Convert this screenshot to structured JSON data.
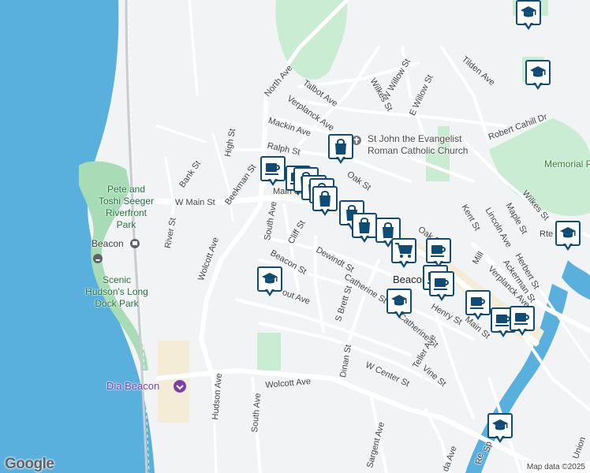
{
  "map": {
    "attribution_logo": "Google",
    "attribution_text": "Map data ©2025",
    "colors": {
      "water": "#5ab0dd",
      "park": "#c9ecd3",
      "land": "#f2f3f5",
      "road": "#ffffff",
      "highlight": "#f5ecd7",
      "marker": "#0f4c75"
    }
  },
  "places": {
    "church_line1": "St John the Evangelist",
    "church_line2": "Roman Catholic Church",
    "memorial_park": "Memorial Park",
    "riverfront_l1": "Pete and",
    "riverfront_l2": "Toshi Seeger",
    "riverfront_l3": "Riverfront",
    "riverfront_l4": "Park",
    "beacon_station": "Beacon",
    "scenic_l1": "Scenic",
    "scenic_l2": "Hudson's Long",
    "scenic_l3": "Dock Park",
    "dia_beacon": "Dia Beacon",
    "town": "Beacon"
  },
  "streets": {
    "north_ave": "North Ave",
    "talbot_ave": "Talbot Ave",
    "verplanck_ave": "Verplanck Ave",
    "mackin_ave": "Mackin Ave",
    "ralph_st": "Ralph St",
    "w_willow_st": "W Willow St",
    "e_willow_st": "E Willow St",
    "wilkes_st": "Wilkes St",
    "tilden_ave": "Tilden Ave",
    "robert_cahill_dr": "Robert Cahill Dr",
    "bank_st": "Bank St",
    "high_st": "High St",
    "beekman_st": "Beekman St",
    "w_main_st": "W Main St",
    "main_st": "Main St",
    "oak_st": "Oak St",
    "oak_st2": "Oak St",
    "river_st": "River St",
    "wolcott_ave": "Wolcott Ave",
    "wolcott_ave2": "Wolcott Ave",
    "south_ave": "South Ave",
    "south_ave2": "South Ave",
    "cliff_st": "Cliff St",
    "beacon_st": "Beacon St",
    "dewindt_st": "Dewindt St",
    "catherine_st": "Catherine St",
    "catherine_st2": "Catherine St",
    "s_brett_st": "S Brett St",
    "prospect": "out Ave",
    "henry_st": "Henry St",
    "kent_st": "Kent St",
    "maple_st": "Maple St",
    "wilkes_st2": "Wilkes St",
    "lincoln_ave": "Lincoln Ave",
    "herbert_st": "Herbert St",
    "ackerman_st": "Ackerman St",
    "verplanck_ave2": "Verplanck Ave",
    "rte": "Rte",
    "mill": "Mill",
    "main_st2": "Main St",
    "dinan_st": "Dinan St",
    "w_center_st": "W Center St",
    "teller_ave": "Teller Ave",
    "vine_st": "Vine St",
    "hudson_ave": "Hudson Ave",
    "sargent_ave": "Sargent Ave",
    "union": "Union",
    "da_ave": "da Ave",
    "re": "Re",
    "sp": "Sp"
  },
  "markers": [
    {
      "type": "school",
      "icon": "school-icon"
    },
    {
      "type": "school",
      "icon": "school-icon"
    },
    {
      "type": "shopping",
      "icon": "shopping-bag-icon"
    },
    {
      "type": "coffee",
      "icon": "coffee-cup-icon"
    },
    {
      "type": "coffee",
      "icon": "coffee-cup-icon"
    },
    {
      "type": "shopping",
      "icon": "shopping-bag-icon"
    },
    {
      "type": "shopping",
      "icon": "shopping-bag-icon"
    },
    {
      "type": "shopping",
      "icon": "shopping-bag-icon"
    },
    {
      "type": "shopping",
      "icon": "shopping-bag-icon"
    },
    {
      "type": "shopping",
      "icon": "shopping-bag-icon"
    },
    {
      "type": "shopping",
      "icon": "shopping-bag-icon"
    },
    {
      "type": "shopping",
      "icon": "shopping-bag-icon"
    },
    {
      "type": "cart",
      "icon": "shopping-cart-icon"
    },
    {
      "type": "coffee",
      "icon": "coffee-cup-icon"
    },
    {
      "type": "coffee",
      "icon": "coffee-cup-icon"
    },
    {
      "type": "school",
      "icon": "school-icon"
    },
    {
      "type": "school",
      "icon": "school-icon"
    },
    {
      "type": "school",
      "icon": "school-icon"
    },
    {
      "type": "coffee",
      "icon": "coffee-cup-icon"
    },
    {
      "type": "coffee",
      "icon": "coffee-cup-icon"
    },
    {
      "type": "coffee",
      "icon": "coffee-cup-icon"
    },
    {
      "type": "coffee",
      "icon": "coffee-cup-icon"
    },
    {
      "type": "school",
      "icon": "school-icon"
    }
  ]
}
